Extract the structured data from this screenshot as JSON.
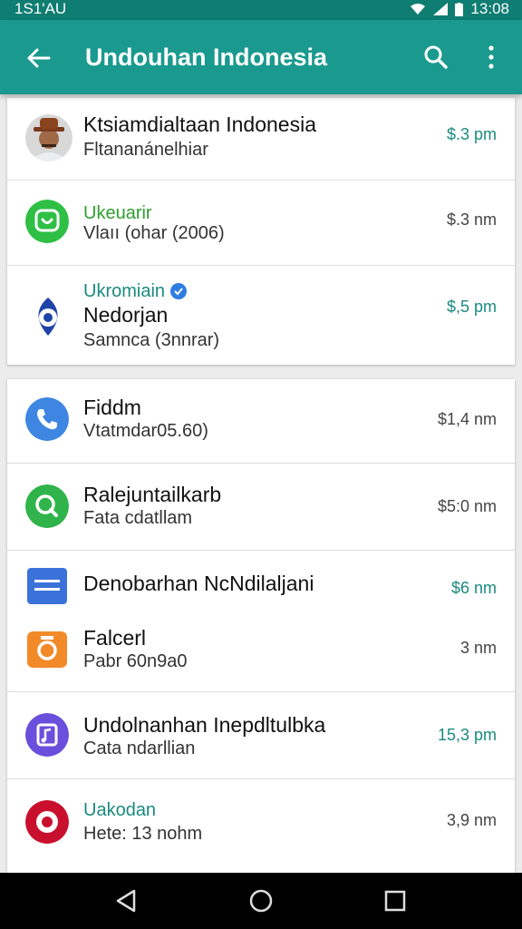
{
  "status_bar": {
    "left_text": "1S1'AU",
    "time": "13:08"
  },
  "app_bar": {
    "title": "Undouhan Indonesia",
    "back_icon": "arrow-left-icon",
    "search_icon": "search-icon",
    "more_icon": "more-vert-icon"
  },
  "card1": {
    "items": [
      {
        "title": "Ktsiamdialtaan Indonesia",
        "subtitle": "Fltananánelhiar",
        "time": "$.3 pm",
        "icon": "avatar-photo"
      },
      {
        "title": "Ukeuarir",
        "subtitle": "Vlaıı (ohar (2006)",
        "time": "$.3 nm",
        "icon": "whatsapp-icon"
      },
      {
        "title": "Ukromiain",
        "subtitle": "Nedorjan",
        "detail": "Samnca (3nnrar)",
        "time": "$,5 pm",
        "icon": "eye-icon"
      }
    ]
  },
  "card2": {
    "items": [
      {
        "title": "Fiddm",
        "subtitle": "Vtatmdar05.60)",
        "time": "$1,4 nm",
        "icon": "phone-icon"
      },
      {
        "title": "Ralejuntailkarb",
        "subtitle": "Fata cdatllam",
        "time": "$5:0 nm",
        "icon": "search-circle-icon"
      },
      {
        "title": "Denobarhan NcNdilaljani",
        "time": "$6 nm",
        "icon": "menu-icon"
      },
      {
        "title": "Falcerl",
        "subtitle": "Pabr 60n9a0",
        "time": "3 nm",
        "icon": "camera-icon"
      },
      {
        "title": "Undolnanhan Inepdltulbka",
        "subtitle": "Cata ndarllian",
        "time": "15,3 pm",
        "icon": "music-icon"
      },
      {
        "title": "Uakodan",
        "subtitle": "Hete: 13 nohm",
        "time": "3,9 nm",
        "icon": "target-icon"
      }
    ]
  },
  "colors": {
    "primary": "#1a9a8f",
    "status_bar": "#0f7d72",
    "accent_green": "#2e9e2e",
    "accent_teal": "#1a8a7e"
  }
}
